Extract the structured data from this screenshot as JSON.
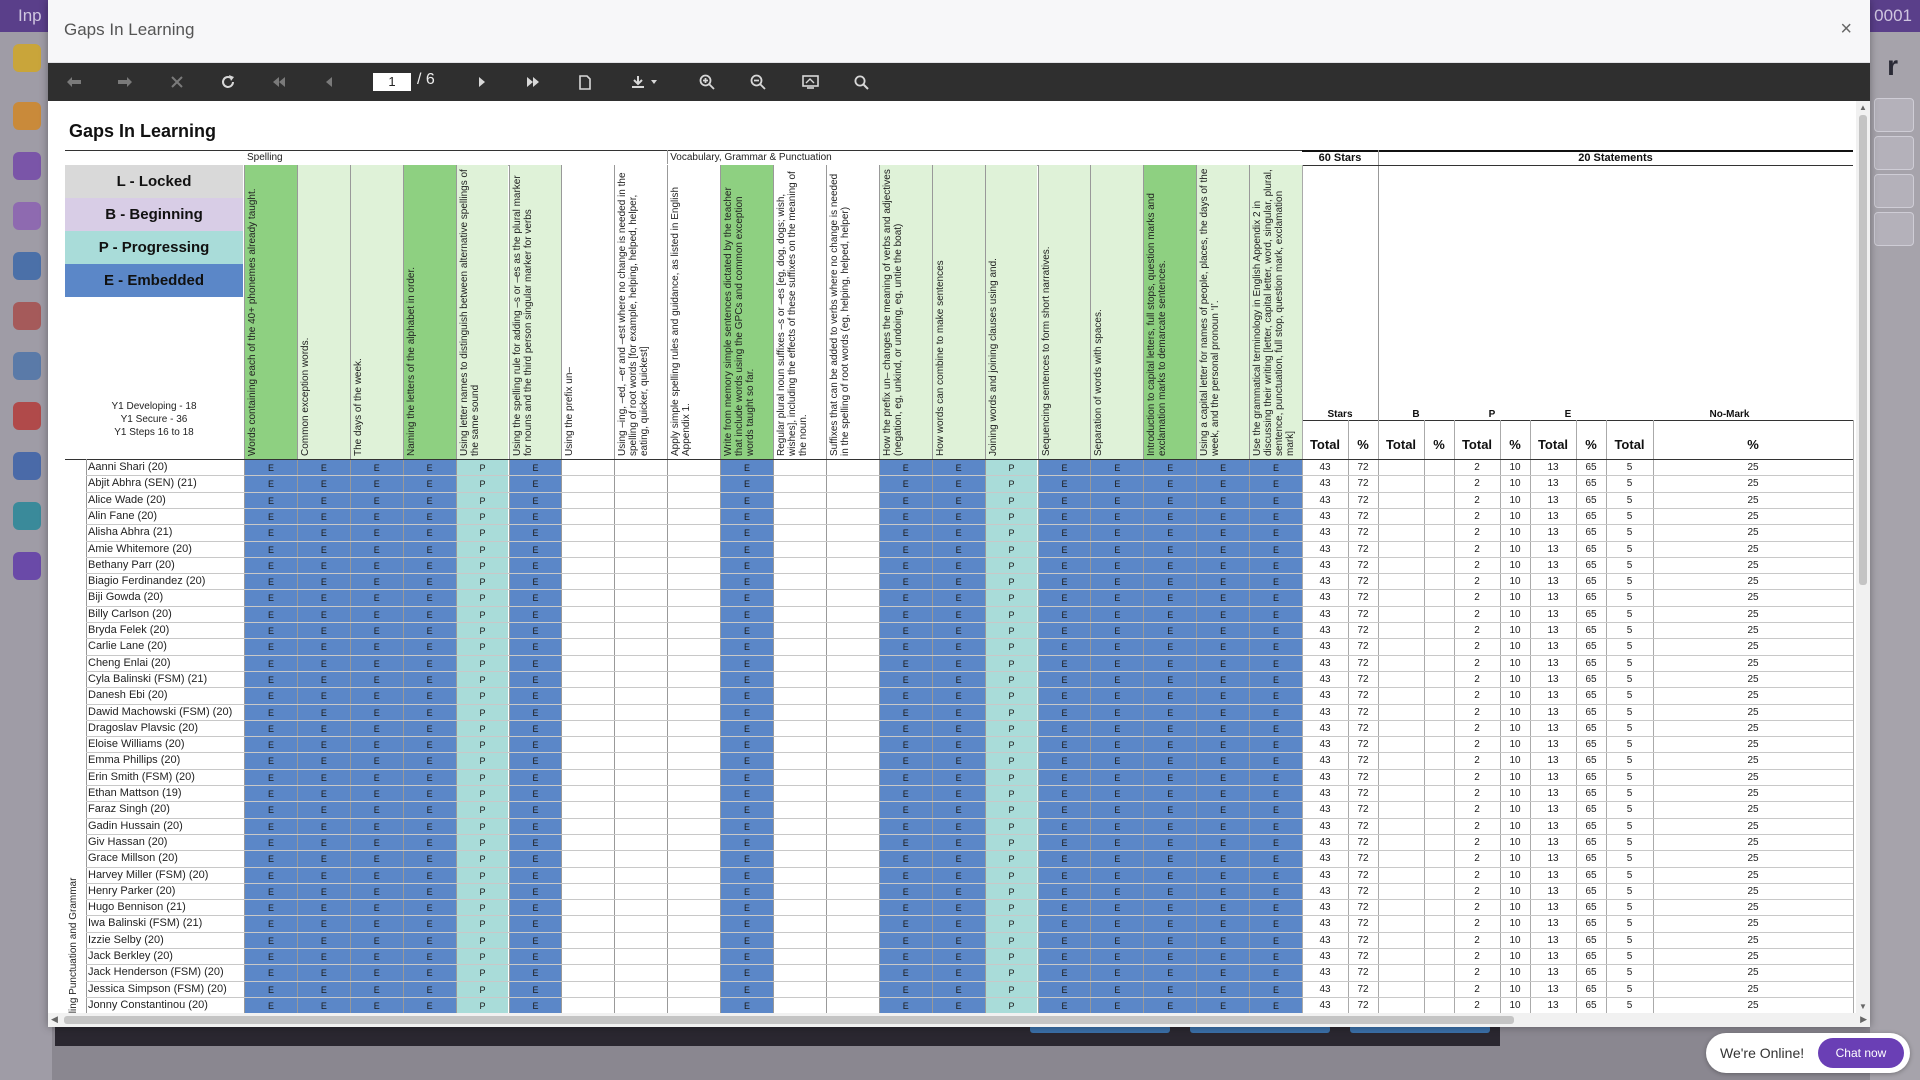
{
  "background": {
    "topbar_left": "Inp",
    "topbar_right": "0001",
    "right_letter": "r"
  },
  "modal": {
    "title": "Gaps In Learning",
    "close": "×"
  },
  "toolbar": {
    "page_current": "1",
    "page_total": "/ 6",
    "icons": [
      "undo-icon",
      "redo-icon",
      "cancel-icon",
      "refresh-icon",
      "first-page-icon",
      "previous-page-icon",
      "next-page-icon",
      "last-page-icon",
      "page-setup-icon",
      "export-icon",
      "zoom-in-icon",
      "zoom-out-icon",
      "fit-page-icon",
      "search-icon"
    ]
  },
  "report": {
    "title": "Gaps In Learning",
    "key": [
      {
        "code": "L - Locked",
        "color": "#d9d9d9"
      },
      {
        "code": "B - Beginning",
        "color": "#d8cde6"
      },
      {
        "code": "P - Progressing",
        "color": "#a9dcd9"
      },
      {
        "code": "E - Embedded",
        "color": "#5b87c8"
      }
    ],
    "key_notes": [
      "Y1 Developing - 18",
      "Y1 Secure - 36",
      "Y1 Steps 16 to 18"
    ],
    "groups": [
      "Spelling",
      "Vocabulary, Grammar & Punctuation"
    ],
    "side_label": "ling Punctuation and Grammar",
    "objectives": [
      "Words containing each of the 40+ phonemes already taught.",
      "Common exception words.",
      "The days of the week.",
      "Naming the letters of the alphabet in order.",
      "Using letter names to distinguish between alternative spellings of the same sound",
      "Using the spelling rule for adding –s or –es as the plural marker for nouns and the third person singular marker for verbs",
      "Using the prefix un–",
      "Using –ing, –ed, –er and –est where no change is needed in the spelling of root words [for example, helping, helped, helper, eating, quicker, quickest]",
      "Apply simple spelling rules and guidance, as listed in English Appendix 1.",
      "Write from memory simple sentences dictated by the teacher that include words using the GPCs and common exception words taught so far.",
      "Regular plural noun suffixes –s or –es [eg, dog, dogs; wish, wishes], including the effects of these suffixes on the meaning of the noun.",
      "Suffixes that can be added to verbs where no change is needed in the spelling of root words (eg, helping, helped, helper)",
      "How the prefix un– changes the meaning of verbs and adjectives (negation, eg, unkind, or undoing, eg, untie the boat)",
      "How words can combine to make sentences",
      "Joining words and joining clauses using and.",
      "Sequencing sentences to form short narratives.",
      "Separation of words with spaces.",
      "Introduction to capital letters, full stops, question marks and exclamation marks to demarcate sentences.",
      "Using a capital letter for names of people, places, the days of the week, and the personal pronoun ‘I’.",
      "Use the grammatical terminology in English Appendix 2 in discussing their writing [letter, capital letter, word, singular, plural, sentence, punctuation, full stop, question mark, exclamation mark]"
    ],
    "objective_header_colors": [
      "#8ed081",
      "#dff2d8",
      "#dff2d8",
      "#8ed081",
      "#dff2d8",
      "#dff2d8",
      "#ffffff",
      "#ffffff",
      "#ffffff",
      "#8ed081",
      "#ffffff",
      "#ffffff",
      "#dff2d8",
      "#dff2d8",
      "#dff2d8",
      "#dff2d8",
      "#dff2d8",
      "#8ed081",
      "#dff2d8",
      "#dff2d8"
    ],
    "summary": {
      "stars_group": "60 Stars",
      "statements_group": "20 Statements",
      "cols": [
        "Stars",
        "B",
        "P",
        "E",
        "No-Mark"
      ],
      "total": "Total",
      "pct": "%"
    },
    "grade_pattern": [
      "E",
      "E",
      "E",
      "E",
      "P",
      "E",
      "",
      "",
      "",
      "E",
      "",
      "",
      "E",
      "E",
      "P",
      "E",
      "E",
      "E",
      "E",
      "E"
    ],
    "grade_colors": {
      "E": "#5b87c8",
      "P": "#a9dcd9",
      "": "#ffffff"
    },
    "totals": [
      "43",
      "72",
      "",
      "",
      "2",
      "10",
      "13",
      "65",
      "5",
      "25"
    ],
    "students": [
      "Aanni Shari (20)",
      "Abjit Abhra (SEN) (21)",
      "Alice Wade (20)",
      "Alin Fane (20)",
      "Alisha Abhra (21)",
      "Amie Whitemore (20)",
      "Bethany Parr (20)",
      "Biagio Ferdinandez (20)",
      "Biji Gowda (20)",
      "Billy Carlson (20)",
      "Bryda Felek (20)",
      "Carlie Lane (20)",
      "Cheng Enlai (20)",
      "Cyla Balinski (FSM) (21)",
      "Danesh Ebi (20)",
      "Dawid Machowski (FSM) (20)",
      "Dragoslav Plavsic (20)",
      "Eloise Williams (20)",
      "Emma Phillips (20)",
      "Erin Smith (FSM) (20)",
      "Ethan Mattson (19)",
      "Faraz Singh (20)",
      "Gadin Hussain (20)",
      "Giv Hassan (20)",
      "Grace Millson (20)",
      "Harvey Miller (FSM) (20)",
      "Henry Parker (20)",
      "Hugo Bennison (21)",
      "Iwa Balinski (FSM) (21)",
      "Izzie Selby (20)",
      "Jack Berkley (20)",
      "Jack Henderson (FSM) (20)",
      "Jessica Simpson (FSM) (20)",
      "Jonny Constantinou (20)"
    ]
  },
  "chat": {
    "status": "We're Online!",
    "button": "Chat now"
  }
}
